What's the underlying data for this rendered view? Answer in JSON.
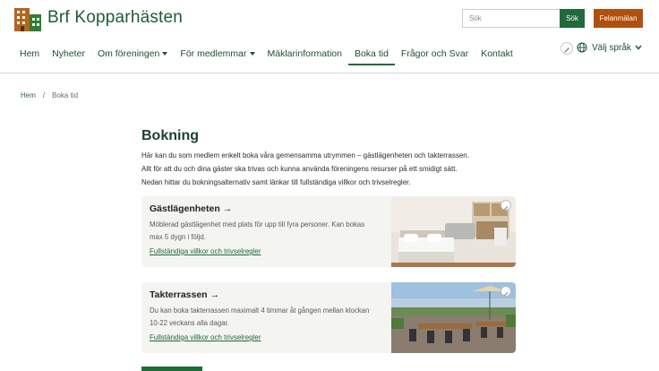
{
  "header": {
    "site_title": "Brf Kopparhästen",
    "search_placeholder": "Sök",
    "search_button": "Sök",
    "report_button": "Felanmälan",
    "language": "Välj språk"
  },
  "nav": {
    "items": [
      {
        "label": "Hem",
        "has_caret": false
      },
      {
        "label": "Nyheter",
        "has_caret": false
      },
      {
        "label": "Om föreningen",
        "has_caret": true
      },
      {
        "label": "För medlemmar",
        "has_caret": true
      },
      {
        "label": "Mäklarinformation",
        "has_caret": false
      },
      {
        "label": "Boka tid",
        "has_caret": false,
        "active": true
      },
      {
        "label": "Frågor och Svar",
        "has_caret": false
      },
      {
        "label": "Kontakt",
        "has_caret": false
      }
    ]
  },
  "breadcrumb": {
    "home": "Hem",
    "separator": "/",
    "current": "Boka tid"
  },
  "main": {
    "title": "Bokning",
    "intro": [
      "Här kan du som medlem enkelt boka våra gemensamma utrymmen – gästlägenheten och takterrassen.",
      "Allt för att du och dina gäster ska trivas och kunna använda föreningens resurser på ett smidigt sätt.",
      "Nedan hittar du bokningsalternativ samt länkar till fullständiga villkor och trivselregler."
    ],
    "cards": [
      {
        "title": "Gästlägenheten →",
        "description": "Möblerad gästlägenhet med plats för upp till fyra personer. Kan bokas max 5 dygn i följd.",
        "link": "Fullständiga villkor och trivselregler",
        "image": "guest-apartment-photo"
      },
      {
        "title": "Takterrassen →",
        "description": "Du kan boka takterrassen maximalt 4 timmar åt gången mellan klockan 10-22 veckans alla dagar.",
        "link": "Fullständiga villkor och trivselregler",
        "image": "roof-terrace-photo"
      }
    ]
  },
  "colors": {
    "brand_green": "#1f6b3a",
    "report_orange": "#b0500f",
    "card_bg": "#f4f4f1"
  }
}
